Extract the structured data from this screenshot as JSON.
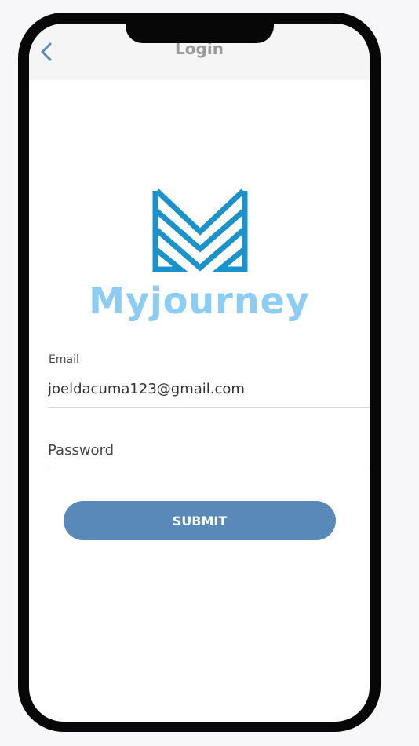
{
  "header": {
    "title": "Login",
    "back_icon": "chevron-left-icon"
  },
  "brand": {
    "name": "Myjourney",
    "logo_icon": "m-chevron-logo-icon",
    "logo_color": "#1a93cc",
    "name_color": "#8ccdf6"
  },
  "form": {
    "email_label": "Email",
    "email_value": "joeldacuma123@gmail.com",
    "password_placeholder": "Password",
    "submit_label": "SUBMIT"
  },
  "colors": {
    "accent": "#5889b8",
    "back_icon": "#5889b8",
    "title": "#9a9a9a"
  }
}
